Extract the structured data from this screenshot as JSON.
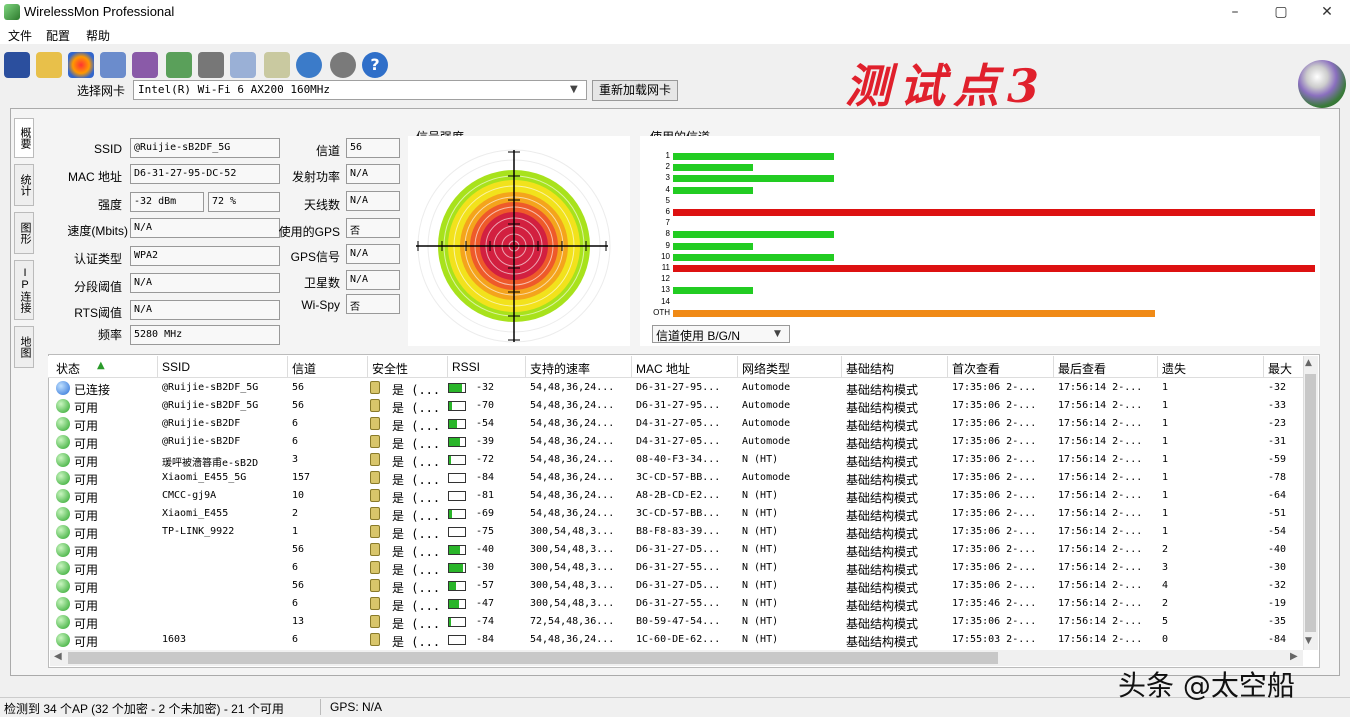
{
  "window": {
    "title": "WirelessMon Professional",
    "min": "–",
    "max": "▢",
    "close": "✕"
  },
  "menu": [
    "文件",
    "配置",
    "帮助"
  ],
  "headline": "测试点3",
  "adapter": {
    "label": "选择网卡",
    "value": "Intel(R) Wi-Fi 6 AX200 160MHz",
    "reload": "重新加载网卡"
  },
  "tabs": [
    "概要",
    "统计",
    "图形",
    "IP连接",
    "地图"
  ],
  "details": {
    "ssid": {
      "label": "SSID",
      "value": "@Ruijie-sB2DF_5G"
    },
    "mac": {
      "label": "MAC 地址",
      "value": "D6-31-27-95-DC-52"
    },
    "strength": {
      "label": "强度",
      "value": "-32 dBm",
      "pct": "72 %"
    },
    "speed": {
      "label": "速度(Mbits)",
      "value": "N/A"
    },
    "auth": {
      "label": "认证类型",
      "value": "WPA2"
    },
    "frag": {
      "label": "分段阈值",
      "value": "N/A"
    },
    "rts": {
      "label": "RTS阈值",
      "value": "N/A"
    },
    "freq": {
      "label": "频率",
      "value": "5280 MHz"
    },
    "channel": {
      "label": "信道",
      "value": "56"
    },
    "txpower": {
      "label": "发射功率",
      "value": "N/A"
    },
    "antenna": {
      "label": "天线数",
      "value": "N/A"
    },
    "gps_used": {
      "label": "使用的GPS",
      "value": "否"
    },
    "gps_signal": {
      "label": "GPS信号",
      "value": "N/A"
    },
    "satellites": {
      "label": "卫星数",
      "value": "N/A"
    },
    "wispy": {
      "label": "Wi-Spy",
      "value": "否"
    }
  },
  "signal_title": "信号强度",
  "channel_title": "使用的信道",
  "channel_filter": "信道使用 B/G/N",
  "channels": [
    {
      "label": "1",
      "level": 0.25,
      "color": "#22cc22"
    },
    {
      "label": "2",
      "level": 0.125,
      "color": "#22cc22"
    },
    {
      "label": "3",
      "level": 0.25,
      "color": "#22cc22"
    },
    {
      "label": "4",
      "level": 0.125,
      "color": "#22cc22"
    },
    {
      "label": "5",
      "level": 0,
      "color": "#22cc22"
    },
    {
      "label": "6",
      "level": 1.0,
      "color": "#dd1111"
    },
    {
      "label": "7",
      "level": 0,
      "color": "#22cc22"
    },
    {
      "label": "8",
      "level": 0.25,
      "color": "#22cc22"
    },
    {
      "label": "9",
      "level": 0.125,
      "color": "#22cc22"
    },
    {
      "label": "10",
      "level": 0.25,
      "color": "#22cc22"
    },
    {
      "label": "11",
      "level": 1.0,
      "color": "#dd1111"
    },
    {
      "label": "12",
      "level": 0,
      "color": "#22cc22"
    },
    {
      "label": "13",
      "level": 0.125,
      "color": "#22cc22"
    },
    {
      "label": "14",
      "level": 0,
      "color": "#22cc22"
    },
    {
      "label": "OTH",
      "level": 0.75,
      "color": "#f08a16"
    }
  ],
  "columns": [
    "状态",
    "SSID",
    "信道",
    "安全性",
    "RSSI",
    "支持的速率",
    "MAC 地址",
    "网络类型",
    "基础结构",
    "首次查看",
    "最后查看",
    "遗失",
    "最大"
  ],
  "rows": [
    {
      "status": "已连接",
      "connected": true,
      "ssid": "@Ruijie-sB2DF_5G",
      "ch": "56",
      "sec": "是 (...",
      "rssi": "-32",
      "lvl": 0.8,
      "rates": "54,48,36,24...",
      "mac": "D6-31-27-95...",
      "type": "Automode",
      "infra": "基础结构模式",
      "first": "17:35:06 2-...",
      "last": "17:56:14 2-...",
      "lost": "1",
      "max": "-32"
    },
    {
      "status": "可用",
      "ssid": "@Ruijie-sB2DF_5G",
      "ch": "56",
      "sec": "是 (...",
      "rssi": "-70",
      "lvl": 0.2,
      "rates": "54,48,36,24...",
      "mac": "D6-31-27-95...",
      "type": "Automode",
      "infra": "基础结构模式",
      "first": "17:35:06 2-...",
      "last": "17:56:14 2-...",
      "lost": "1",
      "max": "-33"
    },
    {
      "status": "可用",
      "ssid": "@Ruijie-sB2DF",
      "ch": "6",
      "sec": "是 (...",
      "rssi": "-54",
      "lvl": 0.5,
      "rates": "54,48,36,24...",
      "mac": "D4-31-27-05...",
      "type": "Automode",
      "infra": "基础结构模式",
      "first": "17:35:06 2-...",
      "last": "17:56:14 2-...",
      "lost": "1",
      "max": "-23"
    },
    {
      "status": "可用",
      "ssid": "@Ruijie-sB2DF",
      "ch": "6",
      "sec": "是 (...",
      "rssi": "-39",
      "lvl": 0.7,
      "rates": "54,48,36,24...",
      "mac": "D4-31-27-05...",
      "type": "Automode",
      "infra": "基础结构模式",
      "first": "17:35:06 2-...",
      "last": "17:56:14 2-...",
      "lost": "1",
      "max": "-31"
    },
    {
      "status": "可用",
      "ssid": "瑗呯被濇簭甫e-sB2D",
      "ch": "3",
      "sec": "是 (...",
      "rssi": "-72",
      "lvl": 0.15,
      "rates": "54,48,36,24...",
      "mac": "08-40-F3-34...",
      "type": "N (HT)",
      "infra": "基础结构模式",
      "first": "17:35:06 2-...",
      "last": "17:56:14 2-...",
      "lost": "1",
      "max": "-59"
    },
    {
      "status": "可用",
      "ssid": "Xiaomi_E455_5G",
      "ch": "157",
      "sec": "是 (...",
      "rssi": "-84",
      "lvl": 0,
      "rates": "54,48,36,24...",
      "mac": "3C-CD-57-BB...",
      "type": "Automode",
      "infra": "基础结构模式",
      "first": "17:35:06 2-...",
      "last": "17:56:14 2-...",
      "lost": "1",
      "max": "-78"
    },
    {
      "status": "可用",
      "ssid": "CMCC-gj9A",
      "ch": "10",
      "sec": "是 (...",
      "rssi": "-81",
      "lvl": 0,
      "rates": "54,48,36,24...",
      "mac": "A8-2B-CD-E2...",
      "type": "N (HT)",
      "infra": "基础结构模式",
      "first": "17:35:06 2-...",
      "last": "17:56:14 2-...",
      "lost": "1",
      "max": "-64"
    },
    {
      "status": "可用",
      "ssid": "Xiaomi_E455",
      "ch": "2",
      "sec": "是 (...",
      "rssi": "-69",
      "lvl": 0.2,
      "rates": "54,48,36,24...",
      "mac": "3C-CD-57-BB...",
      "type": "N (HT)",
      "infra": "基础结构模式",
      "first": "17:35:06 2-...",
      "last": "17:56:14 2-...",
      "lost": "1",
      "max": "-51"
    },
    {
      "status": "可用",
      "ssid": "TP-LINK_9922",
      "ch": "1",
      "sec": "是 (...",
      "rssi": "-75",
      "lvl": 0,
      "rates": "300,54,48,3...",
      "mac": "B8-F8-83-39...",
      "type": "N (HT)",
      "infra": "基础结构模式",
      "first": "17:35:06 2-...",
      "last": "17:56:14 2-...",
      "lost": "1",
      "max": "-54"
    },
    {
      "status": "可用",
      "ssid": "",
      "ch": "56",
      "sec": "是 (...",
      "rssi": "-40",
      "lvl": 0.7,
      "rates": "300,54,48,3...",
      "mac": "D6-31-27-D5...",
      "type": "N (HT)",
      "infra": "基础结构模式",
      "first": "17:35:06 2-...",
      "last": "17:56:14 2-...",
      "lost": "2",
      "max": "-40"
    },
    {
      "status": "可用",
      "ssid": "",
      "ch": "6",
      "sec": "是 (...",
      "rssi": "-30",
      "lvl": 0.85,
      "rates": "300,54,48,3...",
      "mac": "D6-31-27-55...",
      "type": "N (HT)",
      "infra": "基础结构模式",
      "first": "17:35:06 2-...",
      "last": "17:56:14 2-...",
      "lost": "3",
      "max": "-30"
    },
    {
      "status": "可用",
      "ssid": "",
      "ch": "56",
      "sec": "是 (...",
      "rssi": "-57",
      "lvl": 0.45,
      "rates": "300,54,48,3...",
      "mac": "D6-31-27-D5...",
      "type": "N (HT)",
      "infra": "基础结构模式",
      "first": "17:35:06 2-...",
      "last": "17:56:14 2-...",
      "lost": "4",
      "max": "-32"
    },
    {
      "status": "可用",
      "ssid": "",
      "ch": "6",
      "sec": "是 (...",
      "rssi": "-47",
      "lvl": 0.6,
      "rates": "300,54,48,3...",
      "mac": "D6-31-27-55...",
      "type": "N (HT)",
      "infra": "基础结构模式",
      "first": "17:35:46 2-...",
      "last": "17:56:14 2-...",
      "lost": "2",
      "max": "-19"
    },
    {
      "status": "可用",
      "ssid": "",
      "ch": "13",
      "sec": "是 (...",
      "rssi": "-74",
      "lvl": 0.1,
      "rates": "72,54,48,36...",
      "mac": "B0-59-47-54...",
      "type": "N (HT)",
      "infra": "基础结构模式",
      "first": "17:35:06 2-...",
      "last": "17:56:14 2-...",
      "lost": "5",
      "max": "-35"
    },
    {
      "status": "可用",
      "ssid": "1603",
      "ch": "6",
      "sec": "是 (...",
      "rssi": "-84",
      "lvl": 0,
      "rates": "54,48,36,24...",
      "mac": "1C-60-DE-62...",
      "type": "N (HT)",
      "infra": "基础结构模式",
      "first": "17:55:03 2-...",
      "last": "17:56:14 2-...",
      "lost": "0",
      "max": "-84"
    }
  ],
  "status": {
    "summary": "检测到 34 个AP (32 个加密 - 2 个未加密) - 21 个可用",
    "gps": "GPS: N/A"
  },
  "watermark": "头条 @太空船"
}
